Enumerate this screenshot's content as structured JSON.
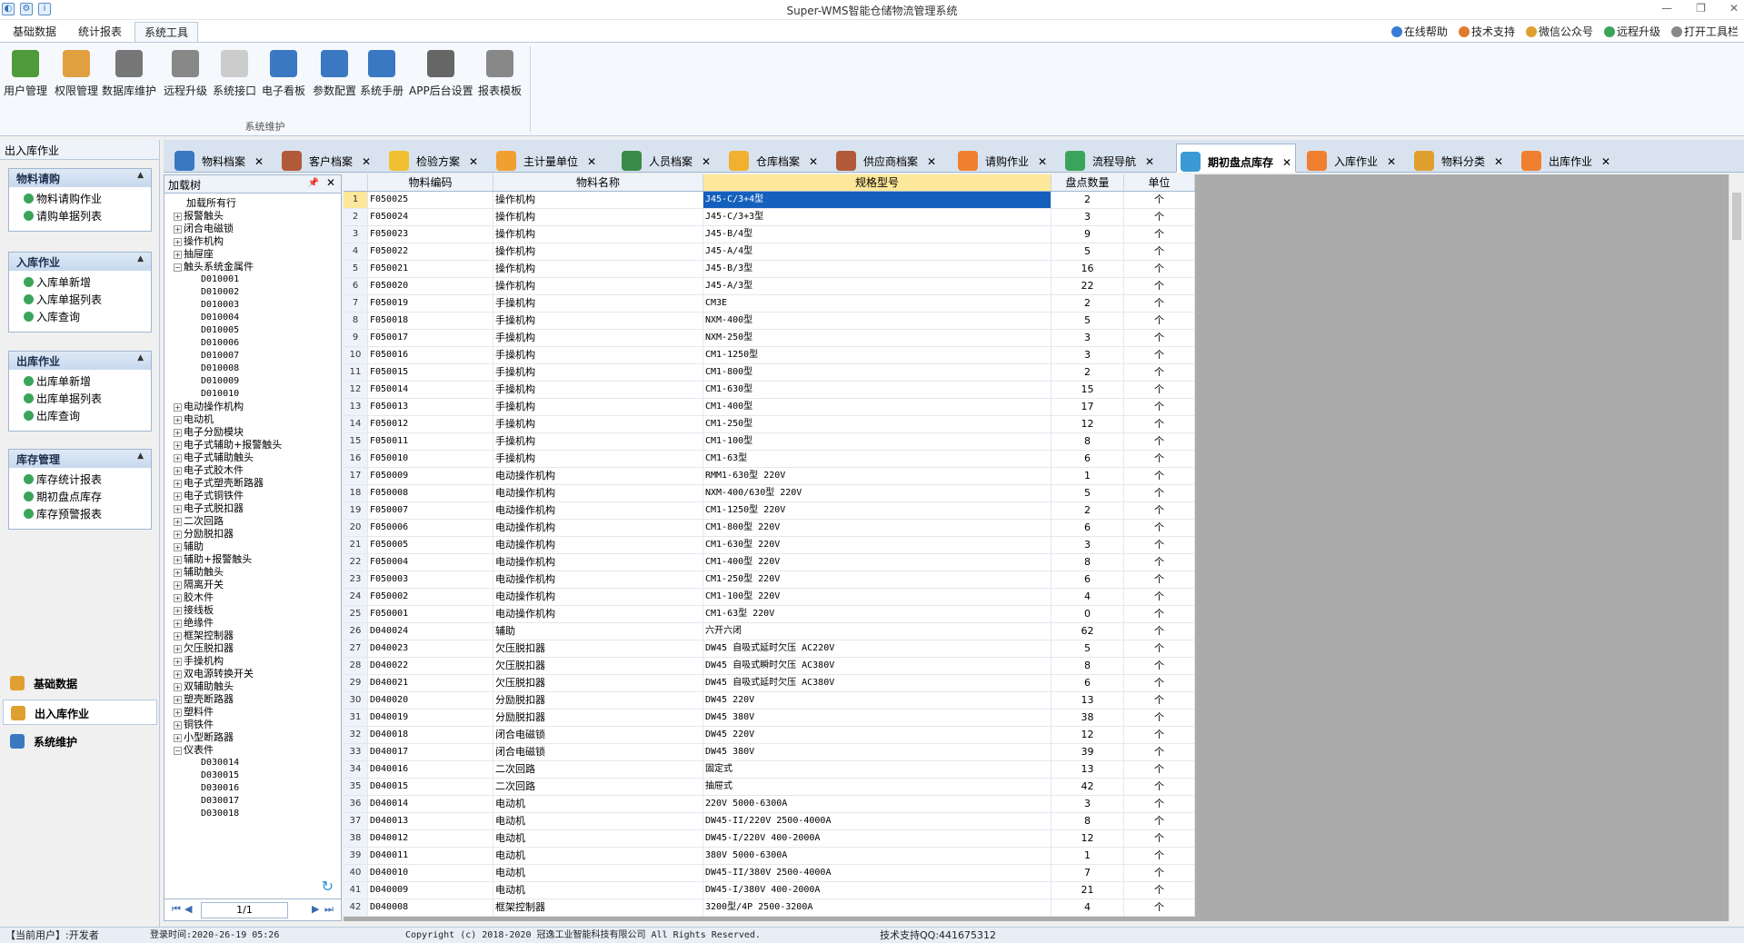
{
  "app": {
    "title": "Super-WMS智能仓储物流管理系统"
  },
  "menubar": {
    "tabs": [
      "基础数据",
      "统计报表",
      "系统工具"
    ],
    "active": 2
  },
  "toplinks": [
    {
      "label": "在线帮助",
      "icon": "help-icon",
      "color": "#3a7bd5"
    },
    {
      "label": "技术支持",
      "icon": "person-icon",
      "color": "#e07a2f"
    },
    {
      "label": "微信公众号",
      "icon": "wechat-icon",
      "color": "#e0a02f"
    },
    {
      "label": "远程升级",
      "icon": "upgrade-icon",
      "color": "#3aa55a"
    },
    {
      "label": "打开工具栏",
      "icon": "toolbar-icon",
      "color": "#888888"
    }
  ],
  "ribbon": {
    "buttons": [
      {
        "label": "用户管理",
        "icon": "users-icon",
        "color": "#4f9a3a"
      },
      {
        "label": "权限管理",
        "icon": "key-icon",
        "color": "#e0a040"
      },
      {
        "label": "数据库维护",
        "icon": "database-icon",
        "color": "#777777"
      },
      {
        "label": "远程升级",
        "icon": "link-icon",
        "color": "#888888"
      },
      {
        "label": "系统接口",
        "icon": "bulb-icon",
        "color": "#cccccc"
      },
      {
        "label": "电子看板",
        "icon": "monitor-icon",
        "color": "#3a78c2"
      },
      {
        "label": "参数配置",
        "icon": "gear-icon",
        "color": "#3a78c2"
      },
      {
        "label": "系统手册",
        "icon": "info-icon",
        "color": "#3a78c2"
      },
      {
        "label": "APP后台设置",
        "icon": "mobile-icon",
        "color": "#666666"
      },
      {
        "label": "报表模板",
        "icon": "printer-icon",
        "color": "#888888"
      }
    ],
    "group_label": "系统维护"
  },
  "leftpanel": {
    "title": "出入库作业",
    "groups": [
      {
        "title": "物料请购",
        "items": [
          "物料请购作业",
          "请购单据列表"
        ]
      },
      {
        "title": "入库作业",
        "items": [
          "入库单新增",
          "入库单据列表",
          "入库查询"
        ]
      },
      {
        "title": "出库作业",
        "items": [
          "出库单新增",
          "出库单据列表",
          "出库查询"
        ]
      },
      {
        "title": "库存管理",
        "items": [
          "库存统计报表",
          "期初盘点库存",
          "库存预警报表"
        ]
      }
    ],
    "nav": [
      {
        "label": "基础数据",
        "color": "#e0a02f"
      },
      {
        "label": "出入库作业",
        "color": "#e0a02f"
      },
      {
        "label": "系统维护",
        "color": "#3a78c2"
      }
    ]
  },
  "doctabs": [
    {
      "label": "物料档案",
      "color": "#3a78c2"
    },
    {
      "label": "客户档案",
      "color": "#b05a3a"
    },
    {
      "label": "检验方案",
      "color": "#f0c030"
    },
    {
      "label": "主计量单位",
      "color": "#f0a030"
    },
    {
      "label": "人员档案",
      "color": "#3a8a4a"
    },
    {
      "label": "仓库档案",
      "color": "#f0b030"
    },
    {
      "label": "供应商档案",
      "color": "#b05a3a"
    },
    {
      "label": "请购作业",
      "color": "#f08030"
    },
    {
      "label": "流程导航",
      "color": "#3aa55a"
    },
    {
      "label": "期初盘点库存",
      "color": "#3a9ad5"
    },
    {
      "label": "入库作业",
      "color": "#f08030"
    },
    {
      "label": "物料分类",
      "color": "#e0a02f"
    },
    {
      "label": "出库作业",
      "color": "#f08030"
    }
  ],
  "active_doctab": 9,
  "tree": {
    "title": "加载树",
    "root": "加载所有行",
    "nodes": [
      {
        "label": "报警触头"
      },
      {
        "label": "闭合电磁锁"
      },
      {
        "label": "操作机构"
      },
      {
        "label": "抽屉座"
      },
      {
        "label": "触头系统金属件",
        "children": [
          "D010001",
          "D010002",
          "D010003",
          "D010004",
          "D010005",
          "D010006",
          "D010007",
          "D010008",
          "D010009",
          "D010010"
        ]
      },
      {
        "label": "电动操作机构"
      },
      {
        "label": "电动机"
      },
      {
        "label": "电子分励模块"
      },
      {
        "label": "电子式辅助+报警触头"
      },
      {
        "label": "电子式辅助触头"
      },
      {
        "label": "电子式胶木件"
      },
      {
        "label": "电子式塑壳断路器"
      },
      {
        "label": "电子式铜铁件"
      },
      {
        "label": "电子式脱扣器"
      },
      {
        "label": "二次回路"
      },
      {
        "label": "分励脱扣器"
      },
      {
        "label": "辅助"
      },
      {
        "label": "辅助+报警触头"
      },
      {
        "label": "辅助触头"
      },
      {
        "label": "隔离开关"
      },
      {
        "label": "胶木件"
      },
      {
        "label": "接线板"
      },
      {
        "label": "绝缘件"
      },
      {
        "label": "框架控制器"
      },
      {
        "label": "欠压脱扣器"
      },
      {
        "label": "手操机构"
      },
      {
        "label": "双电源转换开关"
      },
      {
        "label": "双辅助触头"
      },
      {
        "label": "塑壳断路器"
      },
      {
        "label": "塑料件"
      },
      {
        "label": "铜铁件"
      },
      {
        "label": "小型断路器"
      },
      {
        "label": "仪表件",
        "children": [
          "D030014",
          "D030015",
          "D030016",
          "D030017",
          "D030018"
        ]
      }
    ],
    "page": "1/1"
  },
  "grid": {
    "headers": [
      "物料编码",
      "物料名称",
      "规格型号",
      "盘点数量",
      "单位"
    ],
    "rows": [
      [
        "1",
        "F050025",
        "操作机构",
        "J45-C/3+4型",
        "2",
        "个"
      ],
      [
        "2",
        "F050024",
        "操作机构",
        "J45-C/3+3型",
        "3",
        "个"
      ],
      [
        "3",
        "F050023",
        "操作机构",
        "J45-B/4型",
        "9",
        "个"
      ],
      [
        "4",
        "F050022",
        "操作机构",
        "J45-A/4型",
        "5",
        "个"
      ],
      [
        "5",
        "F050021",
        "操作机构",
        "J45-B/3型",
        "16",
        "个"
      ],
      [
        "6",
        "F050020",
        "操作机构",
        "J45-A/3型",
        "22",
        "个"
      ],
      [
        "7",
        "F050019",
        "手操机构",
        "CM3E",
        "2",
        "个"
      ],
      [
        "8",
        "F050018",
        "手操机构",
        "NXM-400型",
        "5",
        "个"
      ],
      [
        "9",
        "F050017",
        "手操机构",
        "NXM-250型",
        "3",
        "个"
      ],
      [
        "10",
        "F050016",
        "手操机构",
        "CM1-1250型",
        "3",
        "个"
      ],
      [
        "11",
        "F050015",
        "手操机构",
        "CM1-800型",
        "2",
        "个"
      ],
      [
        "12",
        "F050014",
        "手操机构",
        "CM1-630型",
        "15",
        "个"
      ],
      [
        "13",
        "F050013",
        "手操机构",
        "CM1-400型",
        "17",
        "个"
      ],
      [
        "14",
        "F050012",
        "手操机构",
        "CM1-250型",
        "12",
        "个"
      ],
      [
        "15",
        "F050011",
        "手操机构",
        "CM1-100型",
        "8",
        "个"
      ],
      [
        "16",
        "F050010",
        "手操机构",
        "CM1-63型",
        "6",
        "个"
      ],
      [
        "17",
        "F050009",
        "电动操作机构",
        "RMM1-630型    220V",
        "1",
        "个"
      ],
      [
        "18",
        "F050008",
        "电动操作机构",
        "NXM-400/630型  220V",
        "5",
        "个"
      ],
      [
        "19",
        "F050007",
        "电动操作机构",
        "CM1-1250型    220V",
        "2",
        "个"
      ],
      [
        "20",
        "F050006",
        "电动操作机构",
        "CM1-800型     220V",
        "6",
        "个"
      ],
      [
        "21",
        "F050005",
        "电动操作机构",
        "CM1-630型     220V",
        "3",
        "个"
      ],
      [
        "22",
        "F050004",
        "电动操作机构",
        "CM1-400型     220V",
        "8",
        "个"
      ],
      [
        "23",
        "F050003",
        "电动操作机构",
        "CM1-250型     220V",
        "6",
        "个"
      ],
      [
        "24",
        "F050002",
        "电动操作机构",
        "CM1-100型     220V",
        "4",
        "个"
      ],
      [
        "25",
        "F050001",
        "电动操作机构",
        "CM1-63型      220V",
        "0",
        "个"
      ],
      [
        "26",
        "D040024",
        "辅助",
        "六开六闭",
        "62",
        "个"
      ],
      [
        "27",
        "D040023",
        "欠压脱扣器",
        "DW45 自吸式延时欠压 AC220V",
        "5",
        "个"
      ],
      [
        "28",
        "D040022",
        "欠压脱扣器",
        "DW45 自吸式瞬时欠压 AC380V",
        "8",
        "个"
      ],
      [
        "29",
        "D040021",
        "欠压脱扣器",
        "DW45 自吸式延时欠压 AC380V",
        "6",
        "个"
      ],
      [
        "30",
        "D040020",
        "分励脱扣器",
        "DW45  220V",
        "13",
        "个"
      ],
      [
        "31",
        "D040019",
        "分励脱扣器",
        "DW45  380V",
        "38",
        "个"
      ],
      [
        "32",
        "D040018",
        "闭合电磁锁",
        "DW45  220V",
        "12",
        "个"
      ],
      [
        "33",
        "D040017",
        "闭合电磁锁",
        "DW45  380V",
        "39",
        "个"
      ],
      [
        "34",
        "D040016",
        "二次回路",
        "固定式",
        "13",
        "个"
      ],
      [
        "35",
        "D040015",
        "二次回路",
        "抽屉式",
        "42",
        "个"
      ],
      [
        "36",
        "D040014",
        "电动机",
        "220V  5000-6300A",
        "3",
        "个"
      ],
      [
        "37",
        "D040013",
        "电动机",
        "DW45-II/220V 2500-4000A",
        "8",
        "个"
      ],
      [
        "38",
        "D040012",
        "电动机",
        "DW45-I/220V 400-2000A",
        "12",
        "个"
      ],
      [
        "39",
        "D040011",
        "电动机",
        "380V  5000-6300A",
        "1",
        "个"
      ],
      [
        "40",
        "D040010",
        "电动机",
        "DW45-II/380V 2500-4000A",
        "7",
        "个"
      ],
      [
        "41",
        "D040009",
        "电动机",
        "DW45-I/380V 400-2000A",
        "21",
        "个"
      ],
      [
        "42",
        "D040008",
        "框架控制器",
        "3200型/4P 2500-3200A",
        "4",
        "个"
      ]
    ]
  },
  "status": {
    "user": "【当前用户】:开发者",
    "login": "登录时间:2020-26-19 05:26",
    "copyright": "Copyright (c) 2018-2020 冠逸工业智能科技有限公司 All Rights Reserved.",
    "support": "技术支持QQ:441675312"
  }
}
